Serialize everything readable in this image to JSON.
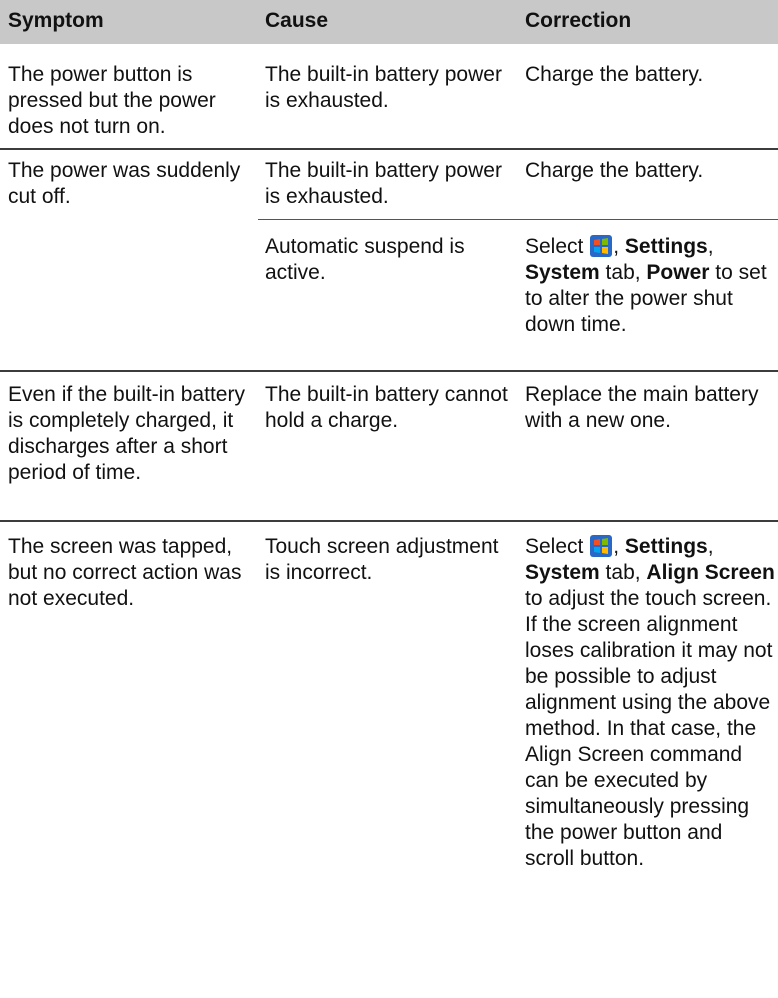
{
  "headers": [
    "Symptom",
    "Cause",
    "Correction"
  ],
  "r1": {
    "symptom": "The power button is pressed but the power does not turn on.",
    "cause": "The built-in battery power is exhausted.",
    "correction": "Charge the battery."
  },
  "r2": {
    "symptom": "The power was suddenly cut off.",
    "cause_a": "The built-in battery power is exhausted.",
    "correction_a": "Charge the battery.",
    "cause_b": "Automatic suspend is active.",
    "sel": "Select",
    "comma1": ", ",
    "settings": "Settings",
    "comma2": ",",
    "system": "System",
    "tab": " tab, ",
    "power": "Power",
    "tail": " to set to alter the power shut down time."
  },
  "r3": {
    "symptom": "Even if the built-in battery is completely charged, it discharges after a short period of time.",
    "cause": "The built-in battery cannot hold a charge.",
    "correction": "Replace the main battery with a new one."
  },
  "r4": {
    "symptom": "The screen was tapped, but no correct action was not executed.",
    "cause": "Touch screen adjustment is incorrect.",
    "sel": "Select",
    "comma1": ", ",
    "settings": "Settings",
    "comma2": ",",
    "system": "System",
    "tab": " tab, ",
    "align": "Align Screen",
    "tail": " to adjust the touch screen. If the screen alignment loses calibration it may not be possible to adjust alignment using the above method. In that case, the Align Screen command can be executed by simultaneously pressing the power button and scroll button."
  },
  "icons": {
    "start": "windows-start-icon"
  },
  "colors": {
    "header_bg": "#c8c8c8",
    "icon_bg": "#2a68c8"
  }
}
